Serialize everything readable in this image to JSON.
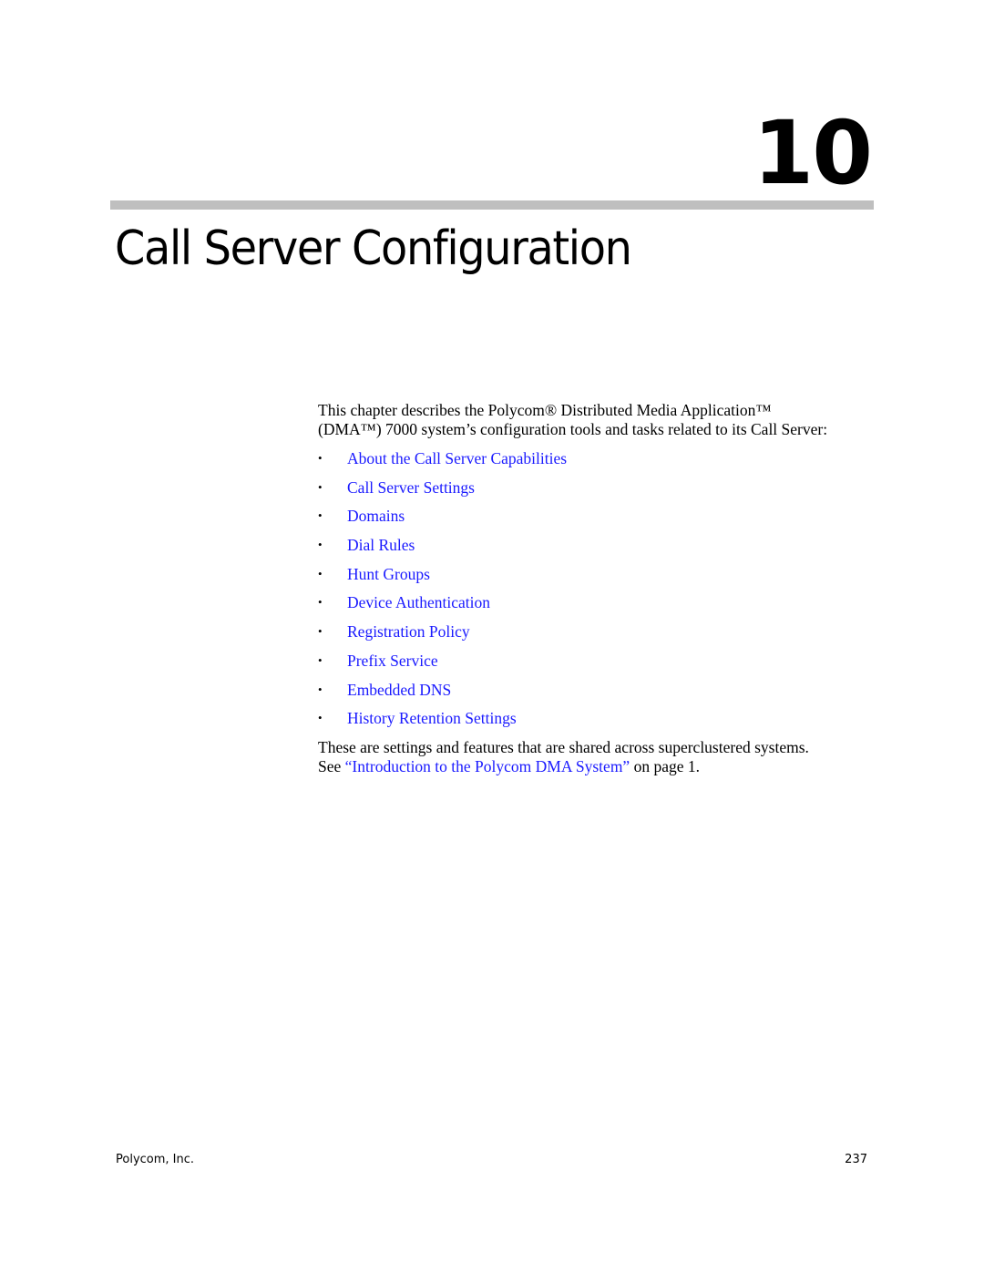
{
  "chapter": {
    "number": "10",
    "title": "Call Server Configuration"
  },
  "intro": {
    "line1": "This chapter describes the Polycom® Distributed Media Application™",
    "line2": "(DMA™) 7000 system’s configuration tools and tasks related to its Call Server:"
  },
  "links": [
    {
      "label": "About the Call Server Capabilities"
    },
    {
      "label": "Call Server Settings"
    },
    {
      "label": "Domains"
    },
    {
      "label": "Dial Rules"
    },
    {
      "label": "Hunt Groups"
    },
    {
      "label": "Device Authentication"
    },
    {
      "label": "Registration Policy"
    },
    {
      "label": "Prefix Service"
    },
    {
      "label": "Embedded DNS"
    },
    {
      "label": "History Retention Settings"
    }
  ],
  "bullet": "•",
  "outro": {
    "line1": "These are settings and features that are shared across superclustered systems.",
    "see": "See ",
    "link": "“Introduction to the Polycom DMA System”",
    "suffix": " on page 1."
  },
  "footer": {
    "company": "Polycom, Inc.",
    "page": "237"
  },
  "colors": {
    "link": "#1a1aff",
    "rule": "#bfbfbf"
  }
}
